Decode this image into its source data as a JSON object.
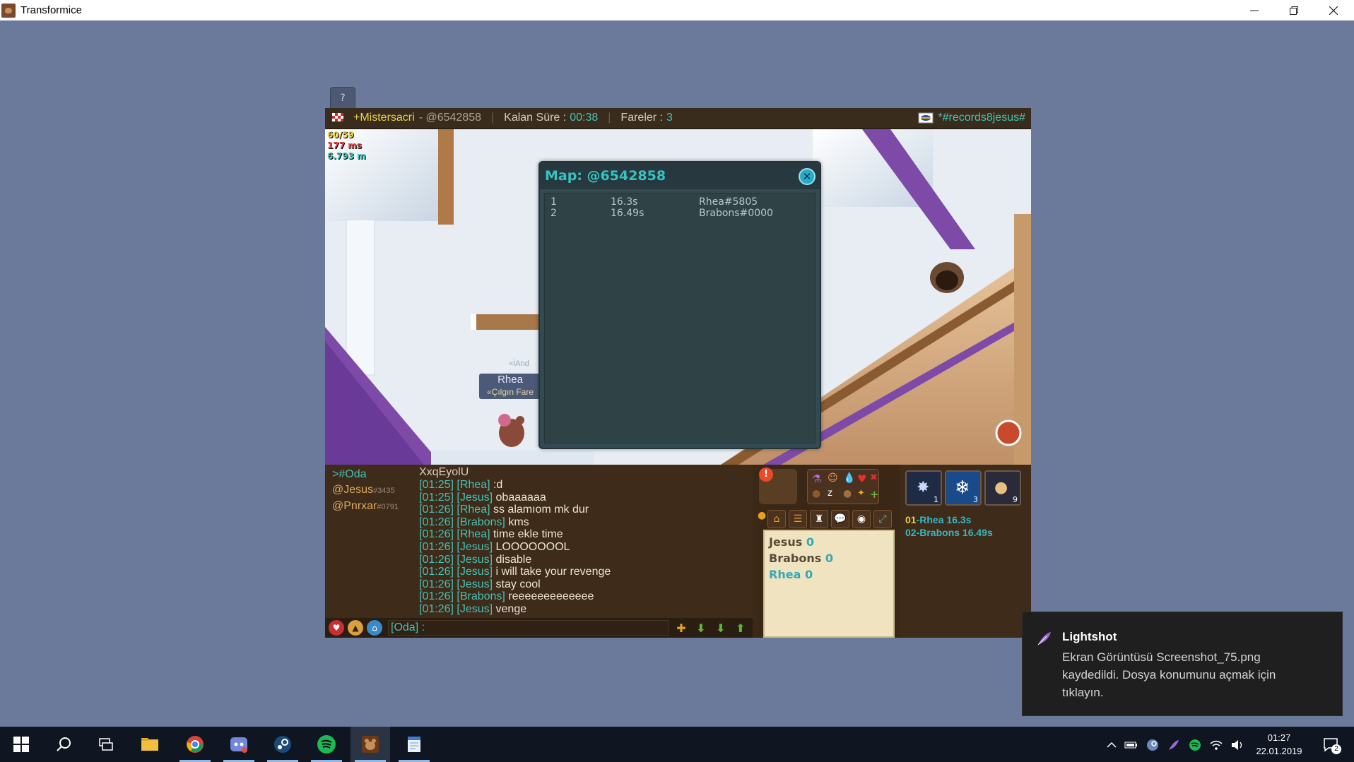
{
  "window": {
    "title": "Transformice"
  },
  "game": {
    "help_label": "?",
    "topbar": {
      "player": "+Mistersacri",
      "map_code": "- @6542858",
      "time_label": "Kalan Süre :",
      "time_value": "00:38",
      "mice_label": "Fareler :",
      "mice_value": "3",
      "room": "*#records8jesus#"
    },
    "stats": {
      "fps": "60/59",
      "ping": "177 ms",
      "distance": "6.793 m"
    },
    "mouse_name": "Rhea",
    "mouse_title": "«Çılgın Fare",
    "dim_label": "«İAnd",
    "map_dialog": {
      "title": "Map: @6542858",
      "close": "✕",
      "rows": [
        {
          "rank": "1",
          "time": "16.3s",
          "player": "Rhea#5805"
        },
        {
          "rank": "2",
          "time": "16.49s",
          "player": "Brabons#0000"
        }
      ]
    },
    "chat": {
      "tabs": [
        {
          "label": ">#Oda",
          "tag": ""
        },
        {
          "label": "@Jesus",
          "tag": "#3435"
        },
        {
          "label": "@Pnrxar",
          "tag": "#0791"
        }
      ],
      "header": "XxqEyolU",
      "lines": [
        {
          "time": "[01:25]",
          "who": "[Rhea]",
          "msg": ":d"
        },
        {
          "time": "[01:25]",
          "who": "[Jesus]",
          "msg": "obaaaaaa"
        },
        {
          "time": "[01:26]",
          "who": "[Rhea]",
          "msg": "ss alamıom mk dur"
        },
        {
          "time": "[01:26]",
          "who": "[Brabons]",
          "msg": "kms"
        },
        {
          "time": "[01:26]",
          "who": "[Rhea]",
          "msg": "time ekle time"
        },
        {
          "time": "[01:26]",
          "who": "[Jesus]",
          "msg": "LOOOOOOOL"
        },
        {
          "time": "[01:26]",
          "who": "[Jesus]",
          "msg": "disable"
        },
        {
          "time": "[01:26]",
          "who": "[Jesus]",
          "msg": "i will take your revenge"
        },
        {
          "time": "[01:26]",
          "who": "[Jesus]",
          "msg": "stay cool"
        },
        {
          "time": "[01:26]",
          "who": "[Brabons]",
          "msg": "reeeeeeeeeeeee"
        },
        {
          "time": "[01:26]",
          "who": "[Jesus]",
          "msg": "venge"
        }
      ],
      "input_value": "[Oda] :"
    },
    "scores": [
      {
        "name": "Jesus",
        "score": "0"
      },
      {
        "name": "Brabons",
        "score": "0"
      },
      {
        "name": "Rhea",
        "score": "0"
      }
    ],
    "map_thumbs": [
      "1",
      "3",
      "9"
    ],
    "leaders": [
      {
        "rank": "01",
        "name": "-Rhea",
        "time": "16.3s"
      },
      {
        "rank": "02",
        "name": "-Brabons",
        "time": "16.49s"
      }
    ]
  },
  "notification": {
    "app": "Lightshot",
    "body": "Ekran Görüntüsü Screenshot_75.png kaydedildi. Dosya konumunu açmak için tıklayın."
  },
  "taskbar": {
    "time": "01:27",
    "date": "22.01.2019",
    "notif_count": "2"
  },
  "colors": {
    "accent_teal": "#45c2b6",
    "chat_bg": "#3e2b1a",
    "dialog_bg": "#324a50",
    "desktop_bg": "#6b7a9a",
    "taskbar_bg": "#0f1622"
  }
}
